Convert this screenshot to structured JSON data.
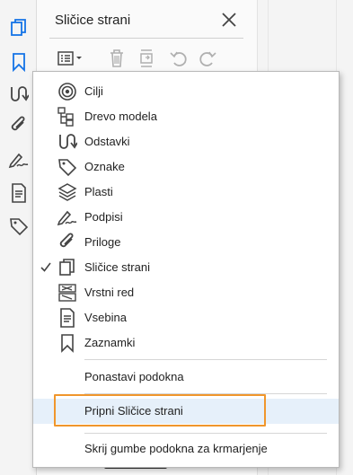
{
  "panel": {
    "title": "Sličice strani"
  },
  "menu": {
    "items": [
      {
        "label": "Cilji",
        "icon": "target-icon"
      },
      {
        "label": "Drevo modela",
        "icon": "model-tree-icon"
      },
      {
        "label": "Odstavki",
        "icon": "paragraph-flow-icon"
      },
      {
        "label": "Oznake",
        "icon": "tag-icon"
      },
      {
        "label": "Plasti",
        "icon": "layers-icon"
      },
      {
        "label": "Podpisi",
        "icon": "signature-pen-icon"
      },
      {
        "label": "Priloge",
        "icon": "paperclip-icon"
      },
      {
        "label": "Sličice strani",
        "icon": "page-thumbnails-icon",
        "checked": true
      },
      {
        "label": "Vrstni red",
        "icon": "reading-order-icon"
      },
      {
        "label": "Vsebina",
        "icon": "content-document-icon"
      },
      {
        "label": "Zaznamki",
        "icon": "bookmark-icon"
      }
    ],
    "reset_label": "Ponastavi podokna",
    "dock_label": "Pripni Sličice strani",
    "hide_label": "Skrij gumbe podokna za krmarjenje"
  },
  "colors": {
    "accent": "#1473e6",
    "highlight_border": "#f0962c",
    "highlight_row": "#e6f0fa"
  }
}
